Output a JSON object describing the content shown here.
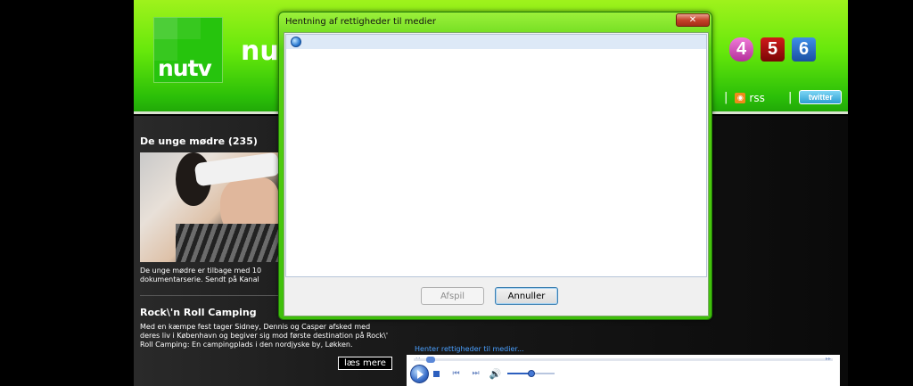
{
  "site": {
    "logo_text": "nutv",
    "brand_text": "nu",
    "channels": [
      "4",
      "5",
      "6"
    ],
    "rss_label": "rss",
    "twitter_label": "twitter",
    "separator": "|"
  },
  "articles": [
    {
      "title": "De unge mødre (235)",
      "description": "De unge mødre er tilbage med 10 dokumentarserie. Sendt på Kanal"
    },
    {
      "title": "Rock\\'n Roll Camping",
      "description": "Med en kæmpe fest tager Sidney, Dennis og Casper afsked med deres liv i København og begiver sig mod første destination på Rock\\' Roll Camping: En campingplads i den nordjyske by, Løkken."
    }
  ],
  "read_more_label": "læs mere",
  "player": {
    "status_text": "Henter rettigheder til medier...",
    "volume_level": 0.5,
    "seek_left": "◂◂",
    "seek_right": "▸▸",
    "prev_symbol": "⏮",
    "next_symbol": "⏭",
    "volume_symbol": "🔊"
  },
  "dialog": {
    "title": "Hentning af rettigheder til medier",
    "close_label": "✕",
    "play_button": "Afspil",
    "cancel_button": "Annuller"
  }
}
